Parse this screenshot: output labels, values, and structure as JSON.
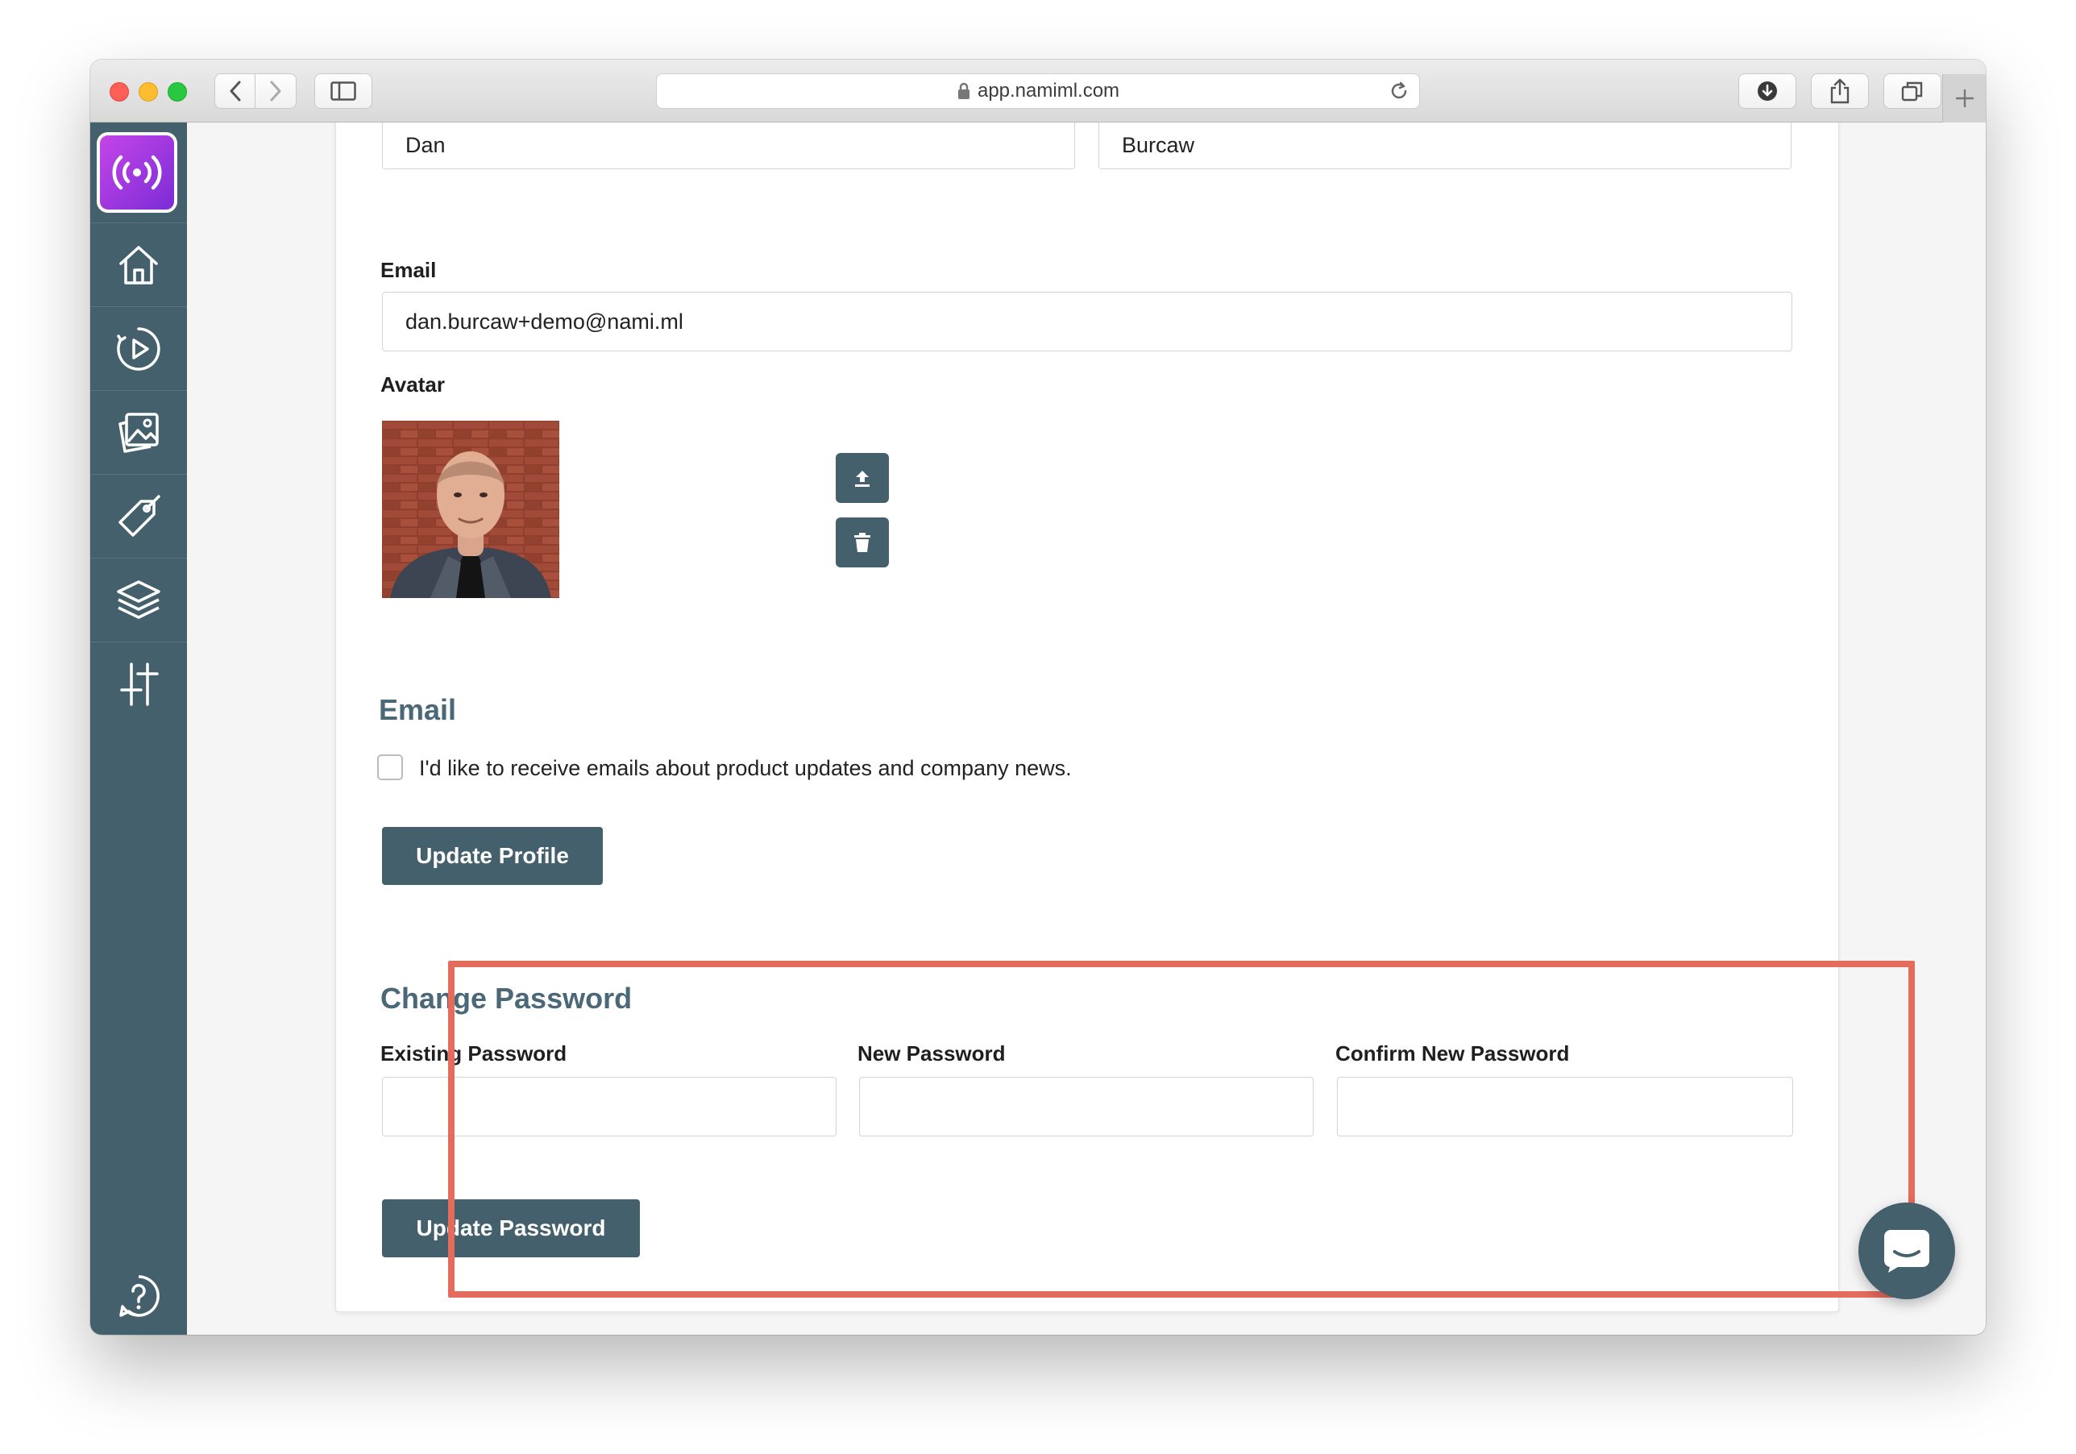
{
  "browser": {
    "url": "app.namiml.com"
  },
  "sidebar": {
    "logo_icon": "broadcast-icon",
    "items": [
      {
        "icon": "home-icon"
      },
      {
        "icon": "play-icon"
      },
      {
        "icon": "gallery-icon"
      },
      {
        "icon": "tag-icon"
      },
      {
        "icon": "layers-icon"
      },
      {
        "icon": "sliders-icon"
      }
    ],
    "help_icon": "help-icon"
  },
  "profile": {
    "first_name_value": "Dan",
    "last_name_value": "Burcaw",
    "email_label": "Email",
    "email_value": "dan.burcaw+demo@nami.ml",
    "avatar_label": "Avatar",
    "email_section_title": "Email",
    "newsletter_checkbox_label": "I'd like to receive emails about product updates and company news.",
    "newsletter_checked": false,
    "update_profile_label": "Update Profile"
  },
  "password": {
    "title": "Change Password",
    "existing_label": "Existing Password",
    "new_label": "New Password",
    "confirm_label": "Confirm New Password",
    "existing_value": "",
    "new_value": "",
    "confirm_value": "",
    "update_password_label": "Update Password"
  },
  "colors": {
    "sidebar": "#44606d",
    "accent": "#44606d",
    "highlight": "#e56b5d",
    "section_title": "#4a6877"
  }
}
